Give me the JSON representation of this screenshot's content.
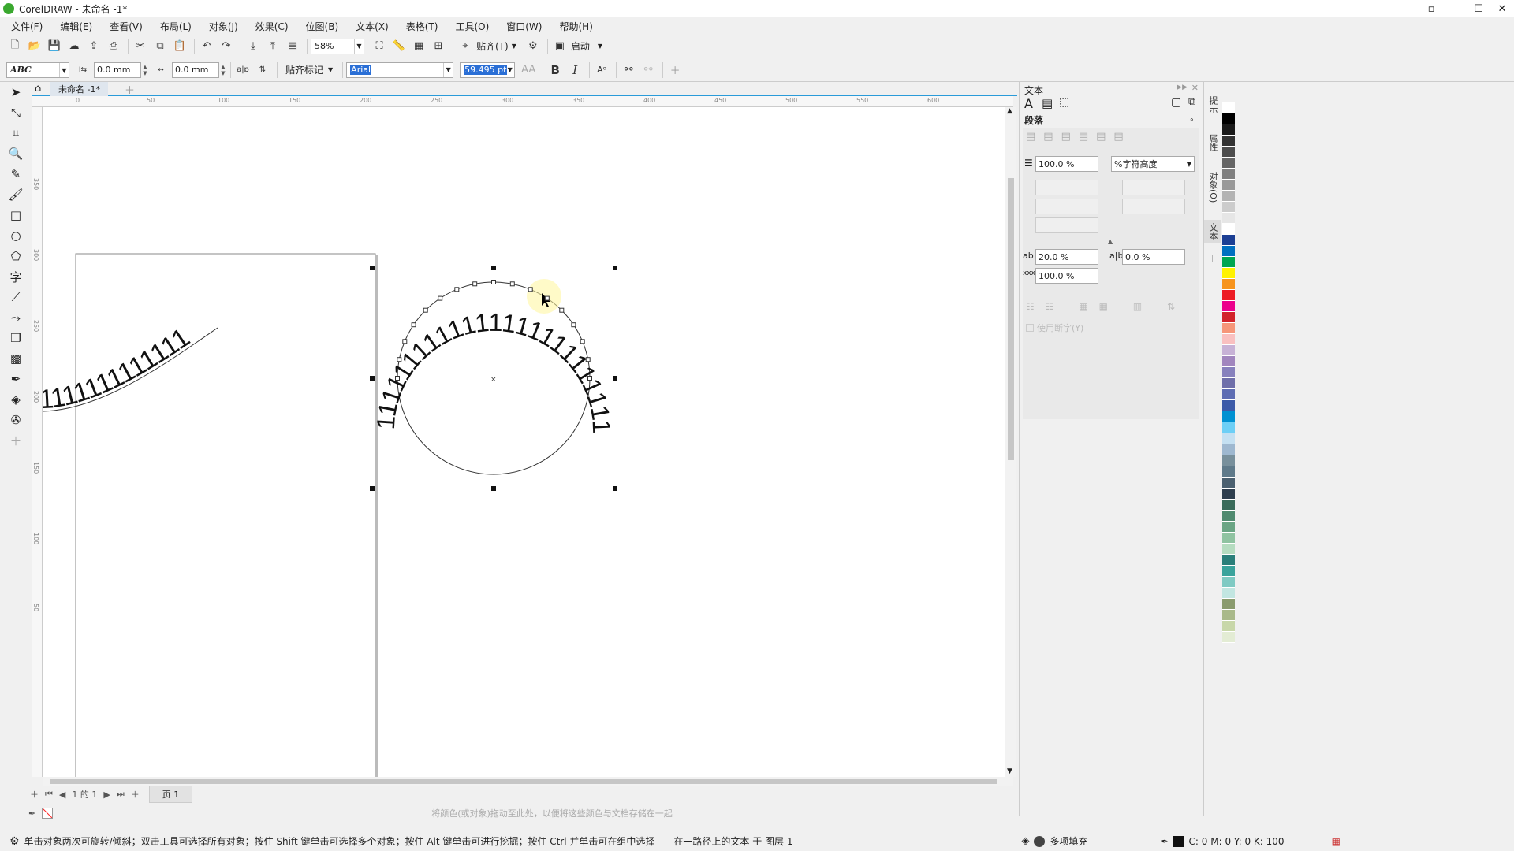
{
  "window": {
    "title": "CorelDRAW - 未命名 -1*"
  },
  "menu": [
    "文件(F)",
    "编辑(E)",
    "查看(V)",
    "布局(L)",
    "对象(J)",
    "效果(C)",
    "位图(B)",
    "文本(X)",
    "表格(T)",
    "工具(O)",
    "窗口(W)",
    "帮助(H)"
  ],
  "toolbar": {
    "zoom": "58%",
    "snap": "贴齐(T)",
    "launch": "启动"
  },
  "propbar": {
    "text_orientation": "ABC",
    "distance_value": "0.0 mm",
    "offset_value": "0.0 mm",
    "snap_marks": "贴齐标记",
    "font_name": "Arial",
    "font_size": "59.495 pt",
    "bold": "B",
    "italic": "I"
  },
  "doc_tab": {
    "label": "未命名 -1*"
  },
  "hruler_ticks": [
    "0",
    "50",
    "100",
    "150",
    "200",
    "250",
    "300",
    "350",
    "400",
    "450",
    "500",
    "550",
    "600"
  ],
  "vruler_ticks": [
    "350",
    "300",
    "250",
    "200",
    "150",
    "100",
    "50"
  ],
  "canvas": {
    "curve_text": "11111111111111",
    "circle_text": "11111111111111111111111111111"
  },
  "page_nav": {
    "page_count": "1 的 1",
    "page_tab": "页 1"
  },
  "color_hint": "将颜色(或对象)拖动至此处，以便将这些颜色与文档存储在一起",
  "docker": {
    "title": "文本",
    "section": "段落",
    "line_spacing": "100.0 %",
    "line_spacing_unit": "%字符高度",
    "char_spacing": "20.0 %",
    "word_spacing": "0.0 %",
    "lang_spacing": "100.0 %",
    "hyphen_label": "使用断字(Y)"
  },
  "side_tabs": [
    "提示",
    "属性",
    "对象(O)",
    "文本"
  ],
  "statusbar": {
    "hint": "单击对象两次可旋转/倾斜；双击工具可选择所有对象；按住 Shift 键单击可选择多个对象；按住 Alt 键单击可进行挖掘；按住 Ctrl 并单击可在组中选择",
    "object_info": "在一路径上的文本 于 图层 1",
    "fill": "多项填充",
    "cmyk": "C: 0 M: 0 Y: 0 K: 100"
  },
  "palette": [
    "#ffffff",
    "#000000",
    "#1a1a1a",
    "#333333",
    "#4d4d4d",
    "#666666",
    "#808080",
    "#999999",
    "#b3b3b3",
    "#cccccc",
    "#e6e6e6",
    "#ffffff",
    "#1c3f94",
    "#0070c0",
    "#00a651",
    "#fff200",
    "#f7941d",
    "#ed1c24",
    "#ec008c",
    "#d2232a",
    "#f69679",
    "#f9c0c0",
    "#c7b2d6",
    "#a186be",
    "#8781bd",
    "#6f6faa",
    "#5e6db3",
    "#3c5aa8",
    "#0091d2",
    "#6dcff6",
    "#c4e0f2",
    "#9eb8d0",
    "#78909c",
    "#5f7a8a",
    "#4b6070",
    "#2e3e4e",
    "#3a6b5a",
    "#4f8a6f",
    "#6aa584",
    "#8fc3a1",
    "#b5dcc0",
    "#2a7f7a",
    "#3aa39c",
    "#7fcac3",
    "#c2e6e1",
    "#8a9b6e",
    "#a9b98a",
    "#c8d7a9",
    "#e3ecd4"
  ]
}
